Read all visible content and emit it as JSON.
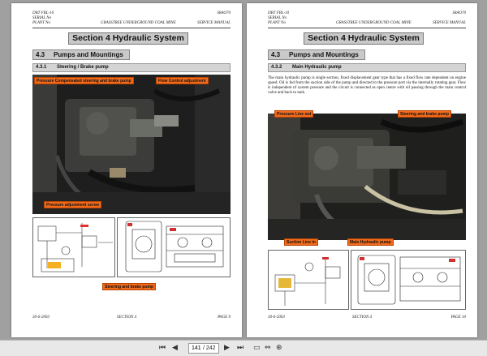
{
  "page_left": {
    "header": {
      "line1_left": "DBT FBL-10",
      "line1_right": "S8AO70",
      "line2_left": "SERIAL No",
      "line3_left": "PLANT No",
      "line3_mid": "GRASSTREE UNDERGROUND COAL MINE",
      "line3_right": "SERVICE MANUAL"
    },
    "section_title": "Section 4   Hydraulic System",
    "subsection_num": "4.3",
    "subsection_title": "Pumps and Mountings",
    "subsub_num": "4.3.1",
    "subsub_title": "Steering / Brake pump",
    "labels": {
      "a": "Pressure Compensated steering and brake pump",
      "b": "Flow Control adjustment",
      "c": "Pressure adjustment  screw",
      "d": "Steering and brake pump"
    },
    "footer": {
      "date": "30-6-2003",
      "section": "SECTION 4",
      "page": "PAGE  9"
    }
  },
  "page_right": {
    "header": {
      "line1_left": "DBT FBL-10",
      "line1_right": "S8AO70",
      "line2_left": "SERIAL No",
      "line3_left": "PLANT No",
      "line3_mid": "GRASSTREE UNDERGROUND COAL MINE",
      "line3_right": "SERVICE MANUAL"
    },
    "section_title": "Section 4   Hydraulic System",
    "subsection_num": "4.3",
    "subsection_title": "Pumps and Mountings",
    "subsub_num": "4.3.2",
    "subsub_title": "Main Hydraulic pump",
    "paragraph": "The main hydraulic pump is single section, fixed displacement gear type that has a fixed flow rate dependent on engine speed. Oil is fed from the suction side of the pump and directed to the pressure port via the internally rotating gear. Flow is independent of system pressure and the circuit is connected as open centre with oil passing through the main control valve and back to tank.",
    "labels": {
      "a": "Pressure Line out",
      "b": "Steering and brake pump",
      "c": "Suction Line in",
      "d": "Main Hydraulic pump"
    },
    "footer": {
      "date": "30-6-2003",
      "section": "SECTION 4",
      "page": "PAGE  10"
    }
  },
  "toolbar": {
    "current_page": "141",
    "total_pages": "/ 242",
    "icons": [
      "first-page-icon",
      "prev-page-icon",
      "next-page-icon",
      "last-page-icon",
      "fit-page-icon",
      "fit-width-icon",
      "zoom-icon"
    ]
  }
}
